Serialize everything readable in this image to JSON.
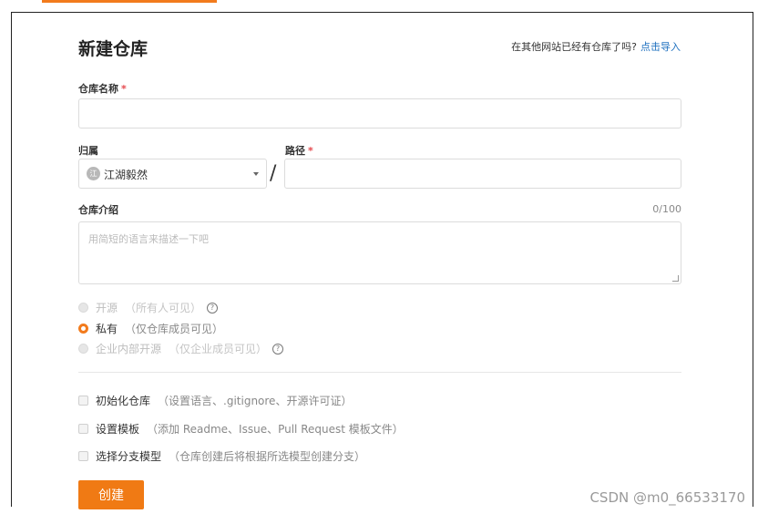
{
  "page": {
    "title": "新建仓库",
    "import_prompt": "在其他网站已经有仓库了吗?",
    "import_link": "点击导入"
  },
  "repo_name": {
    "label": "仓库名称",
    "required": "*",
    "value": ""
  },
  "owner": {
    "label": "归属",
    "avatar_text": "江",
    "selected": "江湖毅然"
  },
  "path": {
    "label": "路径",
    "required": "*",
    "separator": "/",
    "value": ""
  },
  "description": {
    "label": "仓库介绍",
    "counter": "0/100",
    "placeholder": "用简短的语言来描述一下吧"
  },
  "visibility": [
    {
      "label": "开源",
      "desc": "（所有人可见）",
      "selected": false,
      "disabled": true,
      "help": true
    },
    {
      "label": "私有",
      "desc": "（仅仓库成员可见）",
      "selected": true,
      "disabled": false,
      "help": false
    },
    {
      "label": "企业内部开源",
      "desc": "（仅企业成员可见）",
      "selected": false,
      "disabled": true,
      "help": true
    }
  ],
  "options": [
    {
      "label": "初始化仓库",
      "desc": "（设置语言、.gitignore、开源许可证）",
      "checked": false
    },
    {
      "label": "设置模板",
      "desc": "（添加 Readme、Issue、Pull Request 模板文件）",
      "checked": false
    },
    {
      "label": "选择分支模型",
      "desc": "（仓库创建后将根据所选模型创建分支）",
      "checked": false
    }
  ],
  "help_glyph": "?",
  "submit": {
    "label": "创建"
  },
  "watermark": "CSDN @m0_66533170",
  "colors": {
    "accent": "#f27b1d",
    "link": "#1e70bf",
    "required": "#e5484d"
  }
}
